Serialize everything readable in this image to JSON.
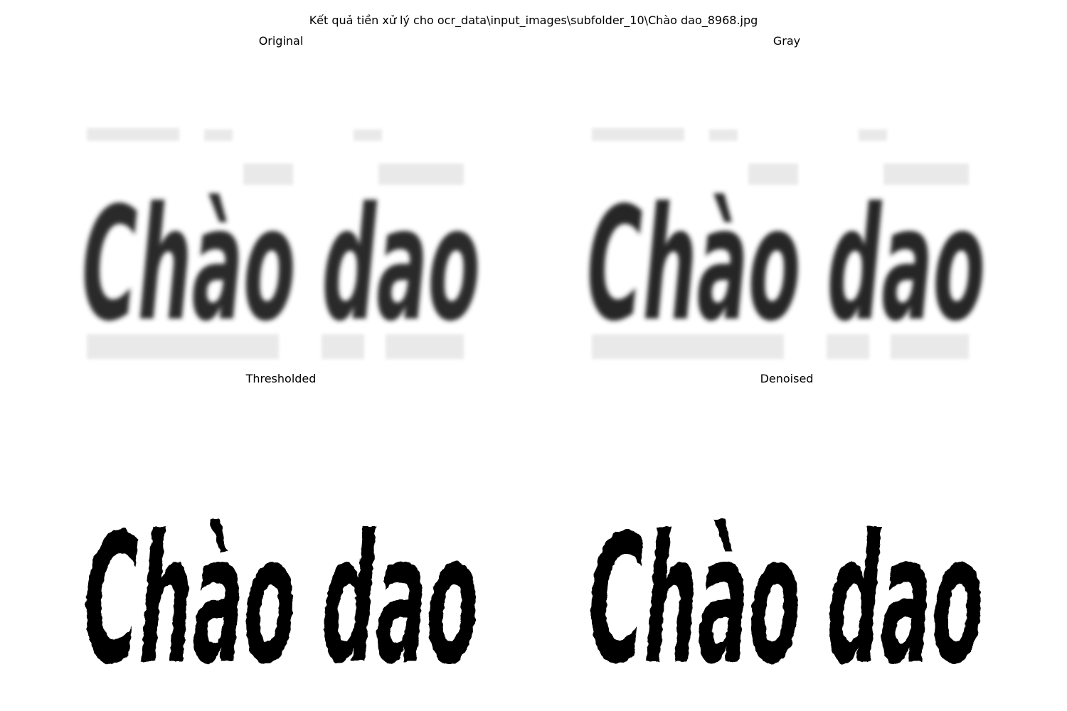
{
  "figure": {
    "title": "Kết quả tiền xử lý cho ocr_data\\input_images\\subfolder_10\\Chào dao_8968.jpg"
  },
  "panels": [
    {
      "id": "original",
      "title": "Original",
      "style": "blurred",
      "ink_color": "#2a2a2a"
    },
    {
      "id": "gray",
      "title": "Gray",
      "style": "blurred",
      "ink_color": "#262626"
    },
    {
      "id": "thresholded",
      "title": "Thresholded",
      "style": "binary",
      "ink_color": "#000000"
    },
    {
      "id": "denoised",
      "title": "Denoised",
      "style": "binary",
      "ink_color": "#000000"
    }
  ],
  "image_word": "Chào dao"
}
